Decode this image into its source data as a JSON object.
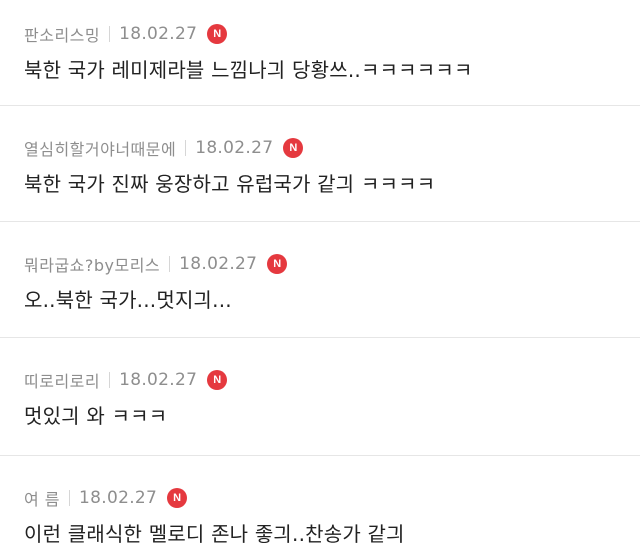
{
  "comments": [
    {
      "nickname": "판소리스밍",
      "date": "18.02.27",
      "badge": "N",
      "text": "북한 국가 레미제라블 느낌나긔 당황쓰..ㅋㅋㅋㅋㅋㅋ"
    },
    {
      "nickname": "열심히할거야너때문에",
      "date": "18.02.27",
      "badge": "N",
      "text": "북한 국가 진짜 웅장하고 유럽국가 같긔 ㅋㅋㅋㅋ"
    },
    {
      "nickname": "뭐라굽쇼?by모리스",
      "date": "18.02.27",
      "badge": "N",
      "text": "오..북한 국가...멋지긔..."
    },
    {
      "nickname": "띠로리로리",
      "date": "18.02.27",
      "badge": "N",
      "text": "멋있긔 와 ㅋㅋㅋ"
    },
    {
      "nickname": "여 름",
      "date": "18.02.27",
      "badge": "N",
      "text": "이런 클래식한 멜로디 존나 좋긔..찬송가 같긔"
    }
  ],
  "colors": {
    "badge": "#e5393f",
    "meta_text": "#8e8e8e",
    "body_text": "#222222",
    "divider": "#e6e6e6"
  }
}
